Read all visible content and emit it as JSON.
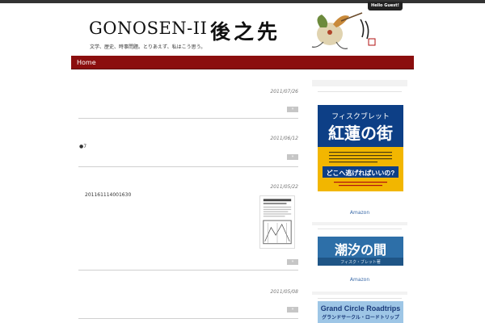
{
  "user_bar": {
    "greeting": "Hello Guest!"
  },
  "header": {
    "site_title": "GONOSEN-II",
    "tagline": "文学、歴史、時事問題。とりあえず、私はこう思う。",
    "logo_text": "後之先"
  },
  "nav": {
    "home": "Home"
  },
  "posts": [
    {
      "date": "2011/07/26",
      "text": "",
      "more": "»"
    },
    {
      "date": "2011/06/12",
      "text": "●7",
      "more": "»"
    },
    {
      "date": "2011/05/22",
      "text": "201161114001630",
      "more": "»"
    },
    {
      "date": "2011/05/08",
      "text": "",
      "more": "»"
    }
  ],
  "sidebar": {
    "books": [
      {
        "line1": "フィスクブレット",
        "title": "紅蓮の街",
        "catch": "どこへ逃げればいいの?",
        "link": "Amazon"
      },
      {
        "title": "潮汐の間",
        "sub": "フィスク・ブレット著",
        "link": "Amazon"
      },
      {
        "title": "Grand Circle Roadtrips",
        "sub": "グランドサークル・ロードトリップ"
      }
    ]
  },
  "colors": {
    "nav_bg": "#8b0e0e",
    "book1_bg": "#f2b600",
    "book1_band": "#0d3f86",
    "book2_bg": "#2d6fa8"
  }
}
